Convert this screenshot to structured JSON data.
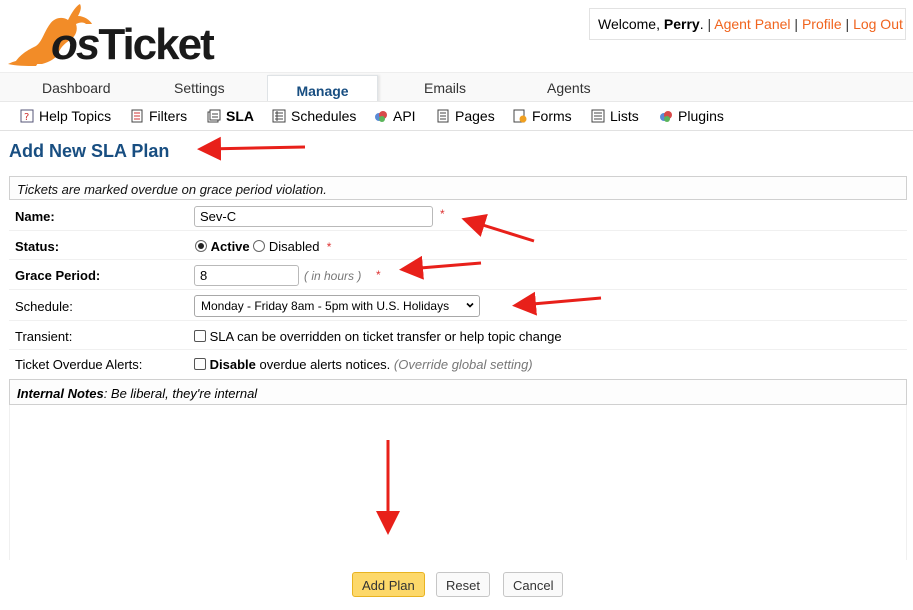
{
  "brand": {
    "logo_text_os": "os",
    "logo_text_ticket": "Ticket"
  },
  "userbar": {
    "welcome_prefix": "Welcome, ",
    "user_name": "Perry",
    "welcome_suffix": ".",
    "separator": "|",
    "agent_panel": "Agent Panel",
    "profile": "Profile",
    "logout": "Log Out"
  },
  "nav": {
    "tabs": [
      "Dashboard",
      "Settings",
      "Manage",
      "Emails",
      "Agents"
    ],
    "active_tab": "Manage"
  },
  "subnav": {
    "items": [
      "Help Topics",
      "Filters",
      "SLA",
      "Schedules",
      "API",
      "Pages",
      "Forms",
      "Lists",
      "Plugins"
    ],
    "active_item": "SLA"
  },
  "page": {
    "title": "Add New SLA Plan",
    "header_note": "Tickets are marked overdue on grace period violation."
  },
  "form": {
    "name_label": "Name:",
    "name_value": "Sev-C",
    "status_label": "Status:",
    "status_active": "Active",
    "status_disabled": "Disabled",
    "status_selected": "Active",
    "grace_label": "Grace Period:",
    "grace_value": "8",
    "grace_hint": "( in hours )",
    "schedule_label": "Schedule:",
    "schedule_value": "Monday - Friday 8am - 5pm with U.S. Holidays",
    "transient_label": "Transient:",
    "transient_text": "SLA can be overridden on ticket transfer or help topic change",
    "transient_checked": false,
    "alerts_label": "Ticket Overdue Alerts:",
    "alerts_bold": "Disable",
    "alerts_text": " overdue alerts notices. ",
    "alerts_hint": "(Override global setting)",
    "alerts_checked": false,
    "required_star": "*",
    "notes_title": "Internal Notes",
    "notes_subtitle": ": Be liberal, they're internal",
    "notes_value": ""
  },
  "buttons": {
    "add": "Add Plan",
    "reset": "Reset",
    "cancel": "Cancel"
  },
  "colors": {
    "brand_orange": "#f0641e",
    "title_blue": "#184e81",
    "annotation_red": "#e8201a",
    "primary_button": "#fdd86a"
  }
}
